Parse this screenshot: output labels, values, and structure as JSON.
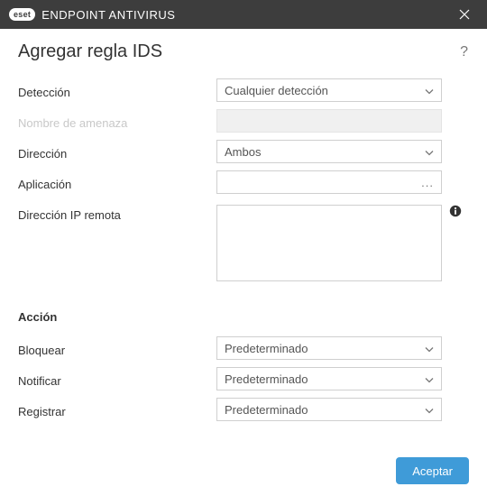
{
  "titlebar": {
    "brand_logo": "eset",
    "brand_text": "ENDPOINT ANTIVIRUS"
  },
  "header": {
    "title": "Agregar regla IDS"
  },
  "form": {
    "detection": {
      "label": "Detección",
      "value": "Cualquier detección"
    },
    "threat_name": {
      "label": "Nombre de amenaza",
      "value": ""
    },
    "direction": {
      "label": "Dirección",
      "value": "Ambos"
    },
    "application": {
      "label": "Aplicación",
      "value": ""
    },
    "remote_ip": {
      "label": "Dirección IP remota",
      "value": ""
    }
  },
  "action_section": {
    "header": "Acción",
    "block": {
      "label": "Bloquear",
      "value": "Predeterminado"
    },
    "notify": {
      "label": "Notificar",
      "value": "Predeterminado"
    },
    "log": {
      "label": "Registrar",
      "value": "Predeterminado"
    }
  },
  "footer": {
    "accept": "Aceptar"
  }
}
